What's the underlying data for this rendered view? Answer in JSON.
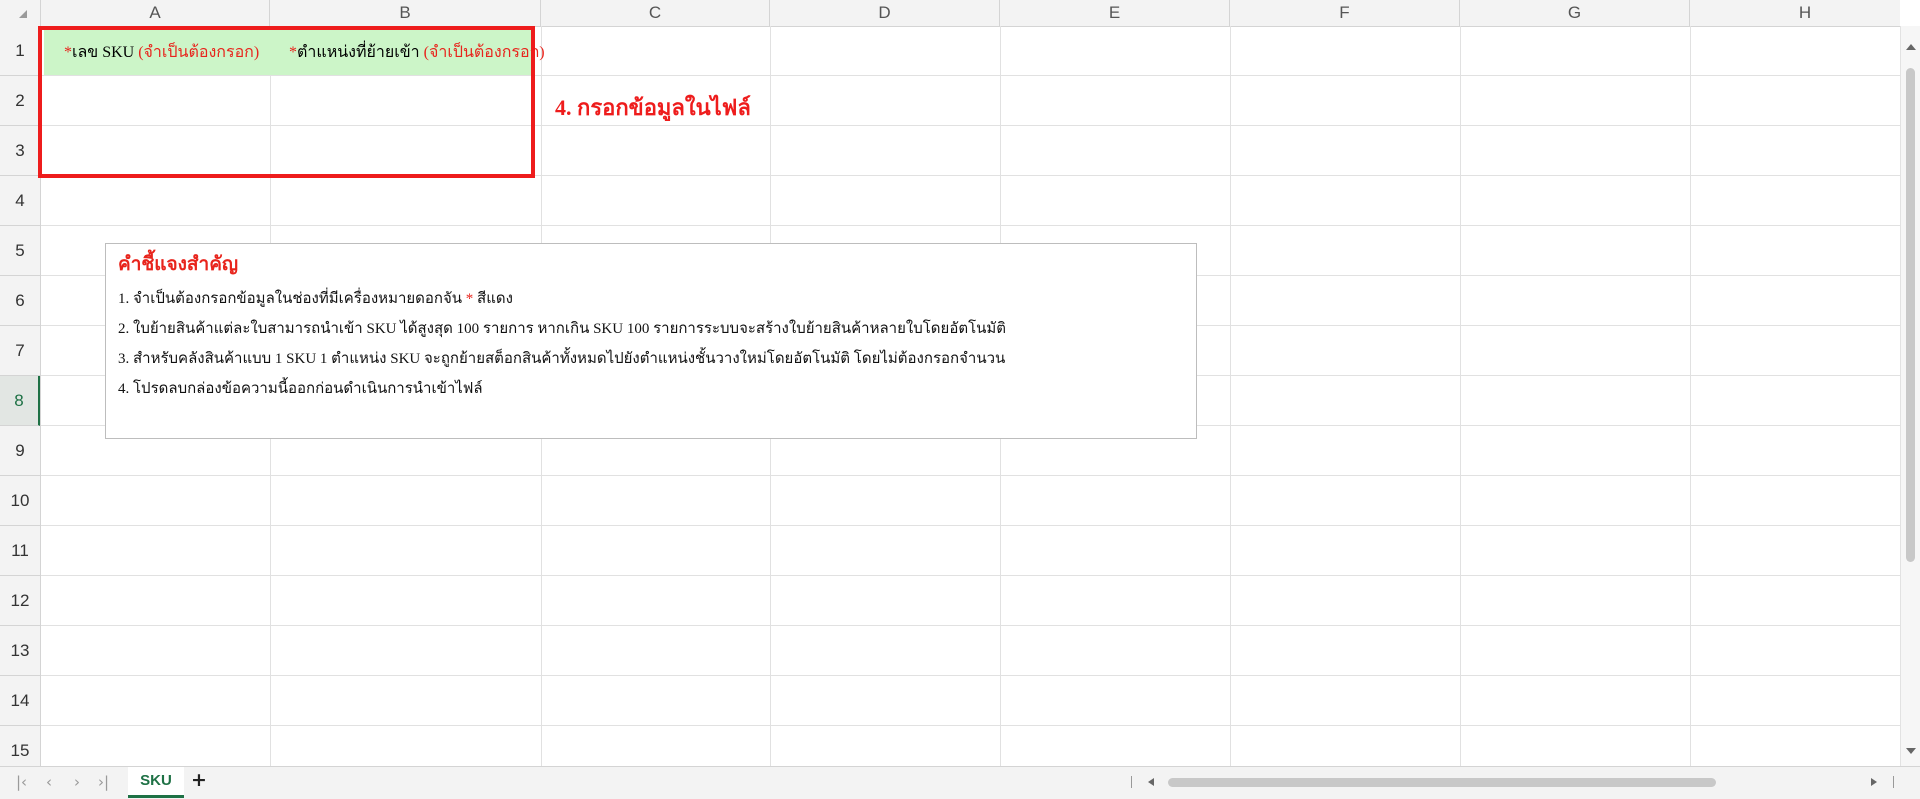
{
  "columns": [
    "A",
    "B",
    "C",
    "D",
    "E",
    "F",
    "G",
    "H"
  ],
  "rows": [
    "1",
    "2",
    "3",
    "4",
    "5",
    "6",
    "7",
    "8",
    "9",
    "10",
    "11",
    "12",
    "13",
    "14",
    "15"
  ],
  "active_row": "8",
  "cells": {
    "a1_star": "*",
    "a1_text": "เลข SKU ",
    "a1_required": "(จำเป็นต้องกรอก)",
    "b1_star": "*",
    "b1_text": "ตำแหน่งที่ย้ายเข้า ",
    "b1_required": "(จำเป็นต้องกรอก)"
  },
  "callout": "4. กรอกข้อมูลในไฟล์",
  "notice": {
    "title": "คำชี้แจงสำคัญ",
    "line1_text": "1. จำเป็นต้องกรอกข้อมูลในช่องที่มีเครื่องหมายดอกจัน ",
    "line1_star": "*",
    "line1_end": " สีแดง",
    "line2": "2. ใบย้ายสินค้าแต่ละใบสามารถนำเข้า SKU ได้สูงสุด 100 รายการ หากเกิน SKU 100 รายการระบบจะสร้างใบย้ายสินค้าหลายใบโดยอัตโนมัติ",
    "line3": "3. สำหรับคลังสินค้าแบบ 1 SKU 1 ตำแหน่ง SKU จะถูกย้ายสต็อกสินค้าทั้งหมดไปยังตำแหน่งชั้นวางใหม่โดยอัตโนมัติ โดยไม่ต้องกรอกจำนวน",
    "line4": "4. โปรดลบกล่องข้อความนี้ออกก่อนดำเนินการนำเข้าไฟล์"
  },
  "sheet_tab": "SKU",
  "add_sheet": "+",
  "nav": {
    "first": "|‹",
    "prev": "‹",
    "next": "›",
    "last": "›|"
  },
  "colors": {
    "accent": "#1e7145",
    "red": "#e8241c",
    "header_fill": "#ccf5c8"
  }
}
